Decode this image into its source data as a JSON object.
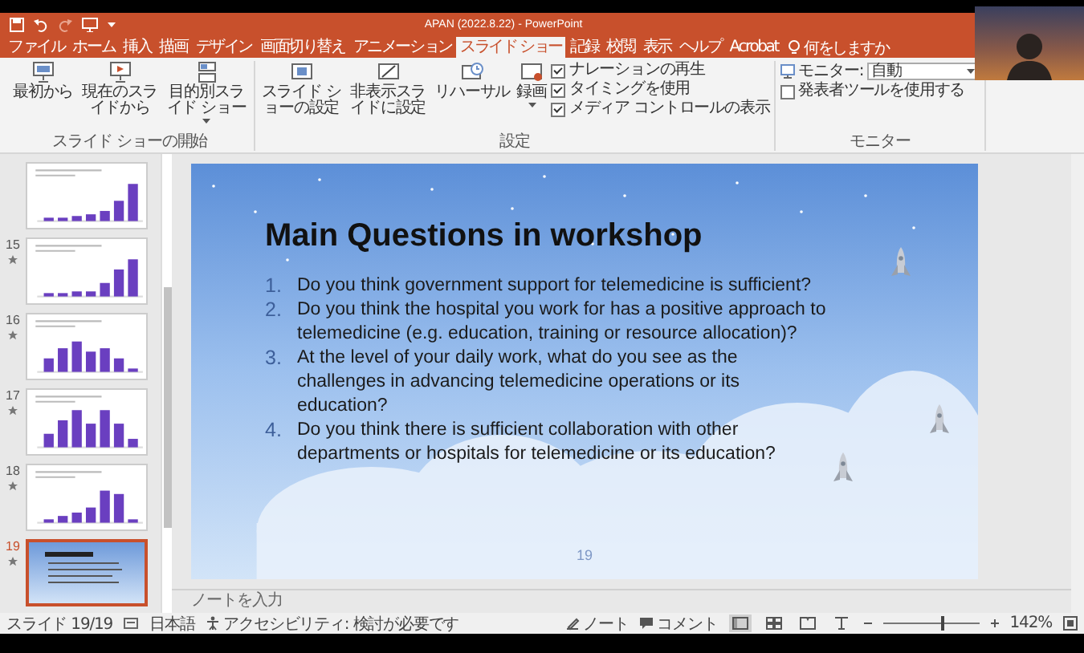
{
  "title_bar": {
    "title": "APAN (2022.8.22)  -  PowerPoint"
  },
  "ribbon_tabs": [
    {
      "label": "ファイル",
      "selected": false
    },
    {
      "label": "ホーム",
      "selected": false
    },
    {
      "label": "挿入",
      "selected": false
    },
    {
      "label": "描画",
      "selected": false
    },
    {
      "label": "デザイン",
      "selected": false
    },
    {
      "label": "画面切り替え",
      "selected": false
    },
    {
      "label": "アニメーション",
      "selected": false
    },
    {
      "label": "スライド ショー",
      "selected": true
    },
    {
      "label": "記録",
      "selected": false
    },
    {
      "label": "校閲",
      "selected": false
    },
    {
      "label": "表示",
      "selected": false
    },
    {
      "label": "ヘルプ",
      "selected": false
    },
    {
      "label": "Acrobat",
      "selected": false
    }
  ],
  "tell_me": {
    "label": "何をしますか"
  },
  "ribbon_groups": [
    {
      "label": "スライド ショーの開始",
      "items": [
        {
          "kind": "button",
          "label": "最初から"
        },
        {
          "kind": "button",
          "label": "現在のスライドから"
        },
        {
          "kind": "menu-button",
          "label": "目的別スライド ショー"
        }
      ]
    },
    {
      "label": "設定",
      "items": [
        {
          "kind": "button",
          "label": "スライド ショーの設定"
        },
        {
          "kind": "button",
          "label": "非表示スライドに設定"
        },
        {
          "kind": "button",
          "label": "リハーサル"
        },
        {
          "kind": "menu-button",
          "label": "録画"
        },
        {
          "kind": "checklist",
          "items": [
            {
              "label": "ナレーションの再生",
              "checked": true
            },
            {
              "label": "タイミングを使用",
              "checked": true
            },
            {
              "label": "メディア コントロールの表示",
              "checked": true
            }
          ]
        }
      ]
    },
    {
      "label": "モニター",
      "items": [
        {
          "kind": "monitor",
          "label": "モニター:",
          "value": "自動",
          "items": [
            {
              "label": "発表者ツールを使用する",
              "checked": false
            }
          ]
        }
      ]
    }
  ],
  "thumbnails": [
    {
      "kind": "chart",
      "selected": false
    },
    {
      "kind": "chart",
      "number": "15",
      "selected": false
    },
    {
      "kind": "chart",
      "number": "16",
      "selected": false
    },
    {
      "kind": "chart",
      "number": "17",
      "selected": false
    },
    {
      "kind": "chart",
      "number": "18",
      "selected": false
    },
    {
      "kind": "title-slide",
      "number": "19",
      "selected": true
    }
  ],
  "slide": {
    "title": "Main Questions in workshop",
    "questions": [
      {
        "number": "1.",
        "text": "Do you think government support for telemedicine is sufficient?"
      },
      {
        "number": "2.",
        "text": "Do you think the hospital you work for has a positive approach to telemedicine (e.g. education, training or resource allocation)?"
      },
      {
        "number": "3.",
        "text": "At the level of your daily work, what do you see as the challenges in advancing telemedicine operations or its education?"
      },
      {
        "number": "4.",
        "text": "Do you think there is sufficient collaboration with other departments or hospitals for telemedicine or its education?"
      }
    ],
    "page_number": "19"
  },
  "notes": {
    "placeholder": "ノートを入力"
  },
  "status_bar": {
    "slide_counter": "スライド 19/19",
    "language": "日本語",
    "accessibility": "アクセシビリティ: 検討が必要です",
    "notes_button": "ノート",
    "comments_button": "コメント",
    "views": [
      {
        "selected": true
      },
      {
        "selected": false
      },
      {
        "selected": false
      },
      {
        "selected": false
      }
    ],
    "zoom": {
      "level": 0.62,
      "reading": "142%"
    }
  }
}
